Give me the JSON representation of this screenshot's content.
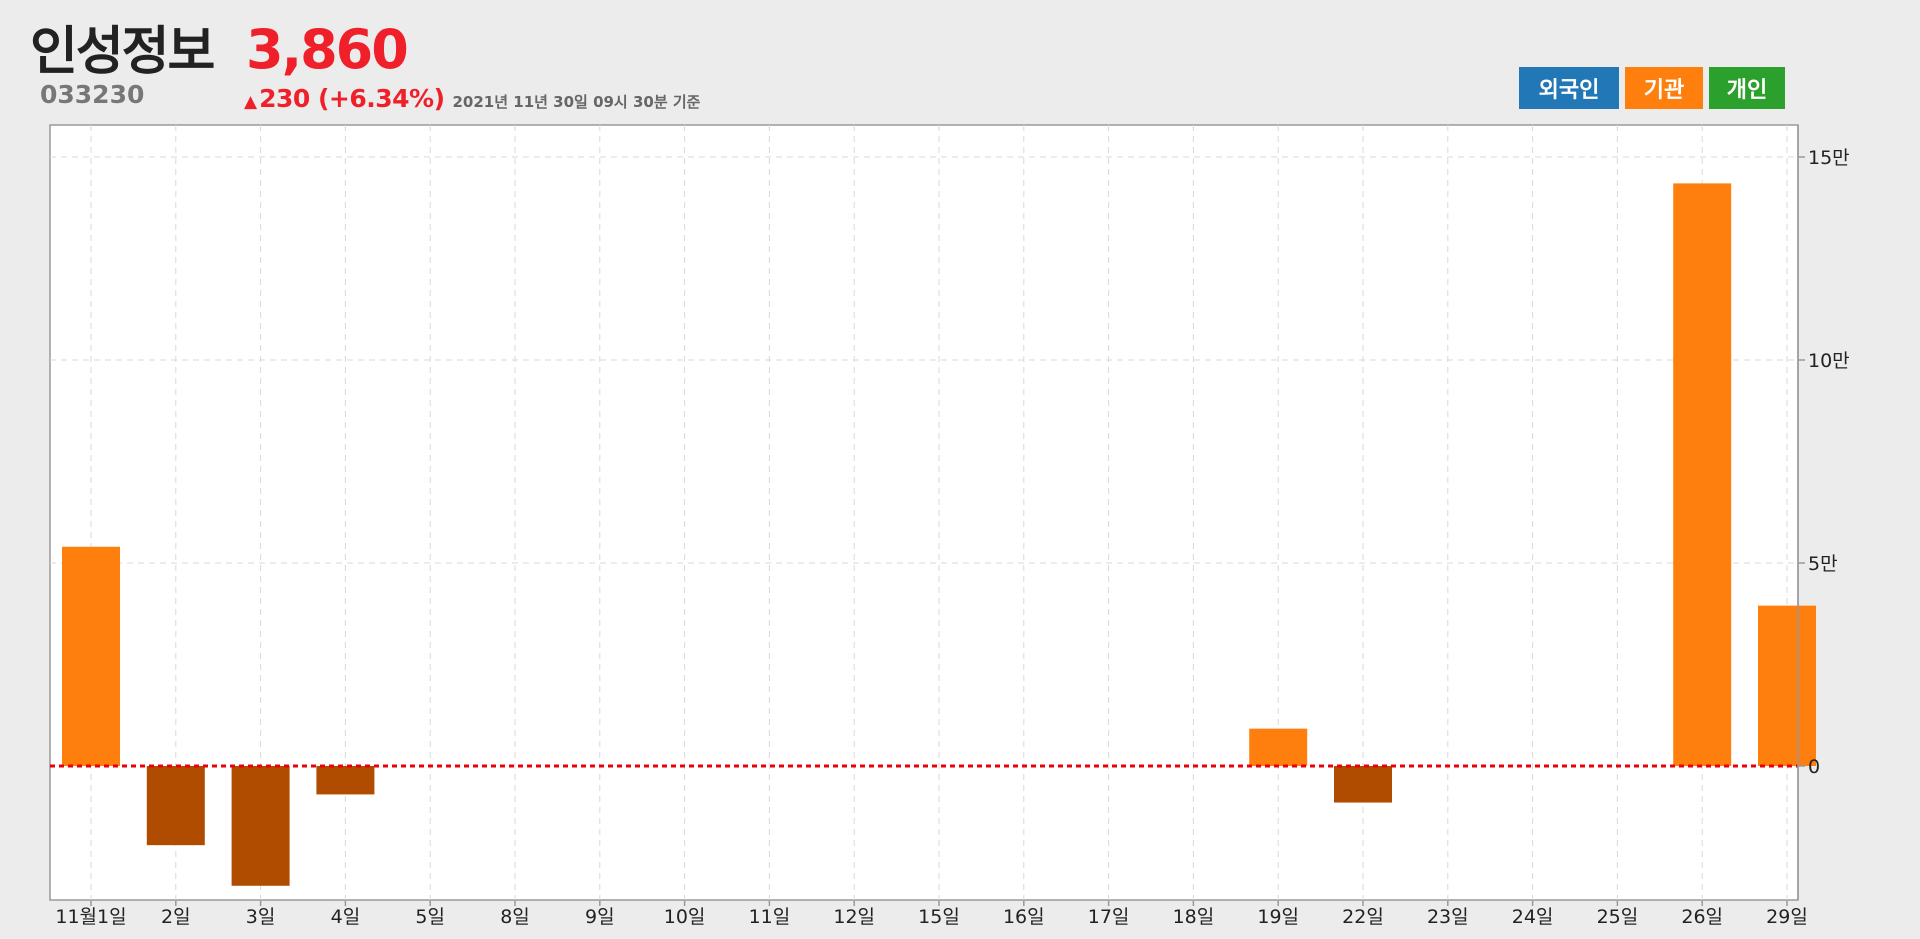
{
  "header": {
    "name": "인성정보",
    "code": "033230",
    "price": "3,860",
    "arrow": "▲",
    "change": "230 (+6.34%)",
    "as_of": "2021년 11년 30일 09시 30분 기준"
  },
  "legend": [
    {
      "label": "외국인",
      "color": "#2277b6"
    },
    {
      "label": "기관",
      "color": "#ff7f0e"
    },
    {
      "label": "개인",
      "color": "#2ca02c"
    }
  ],
  "chart_data": {
    "type": "bar",
    "series": [
      {
        "name": "기관",
        "values": [
          54000,
          -19500,
          -29500,
          -7000,
          0,
          0,
          0,
          0,
          0,
          0,
          0,
          0,
          0,
          0,
          9200,
          -9000,
          0,
          0,
          0,
          143500,
          39500
        ]
      }
    ],
    "categories": [
      "11월1일",
      "2일",
      "3일",
      "4일",
      "5일",
      "8일",
      "9일",
      "10일",
      "11일",
      "12일",
      "15일",
      "16일",
      "17일",
      "18일",
      "19일",
      "22일",
      "23일",
      "24일",
      "25일",
      "26일",
      "29일"
    ],
    "ylim": [
      -33000,
      157500
    ],
    "yticks": [
      {
        "value": 0,
        "label": "0"
      },
      {
        "value": 50000,
        "label": "5만"
      },
      {
        "value": 100000,
        "label": "10만"
      },
      {
        "value": 150000,
        "label": "15만"
      }
    ],
    "colors": {
      "positive": "#ff7f0e",
      "negative": "#b04c00",
      "zero_line": "#e8000b"
    },
    "grid": true,
    "legend_position": "top-right"
  }
}
